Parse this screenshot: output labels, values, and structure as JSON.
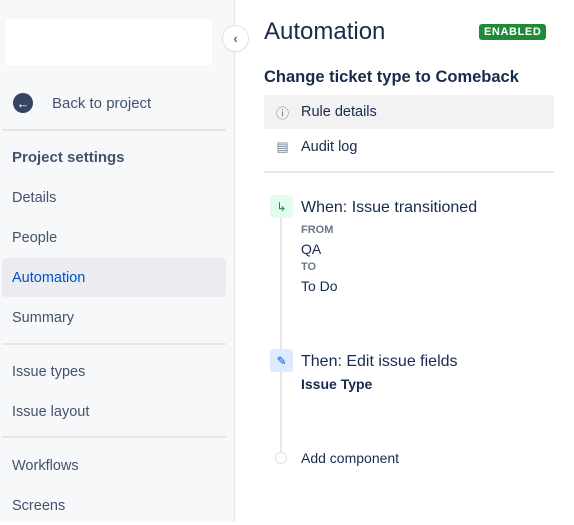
{
  "sidebar": {
    "back_label": "Back to project",
    "section_title": "Project settings",
    "items": [
      {
        "label": "Details"
      },
      {
        "label": "People"
      },
      {
        "label": "Automation",
        "selected": true
      },
      {
        "label": "Summary"
      },
      {
        "label": "Issue types"
      },
      {
        "label": "Issue layout"
      },
      {
        "label": "Workflows"
      },
      {
        "label": "Screens"
      }
    ]
  },
  "header": {
    "title": "Automation",
    "status": "ENABLED",
    "status_color": "#1f8b3a"
  },
  "rule": {
    "name": "Change ticket type to Comeback",
    "menu": [
      {
        "label": "Rule details",
        "icon": "info-icon",
        "selected": true
      },
      {
        "label": "Audit log",
        "icon": "document-icon"
      }
    ],
    "trigger": {
      "title": "When: Issue transitioned",
      "from_label": "FROM",
      "from": "QA",
      "to_label": "TO",
      "to": "To Do"
    },
    "action": {
      "title": "Then: Edit issue fields",
      "field": "Issue Type"
    },
    "add_label": "Add component"
  }
}
